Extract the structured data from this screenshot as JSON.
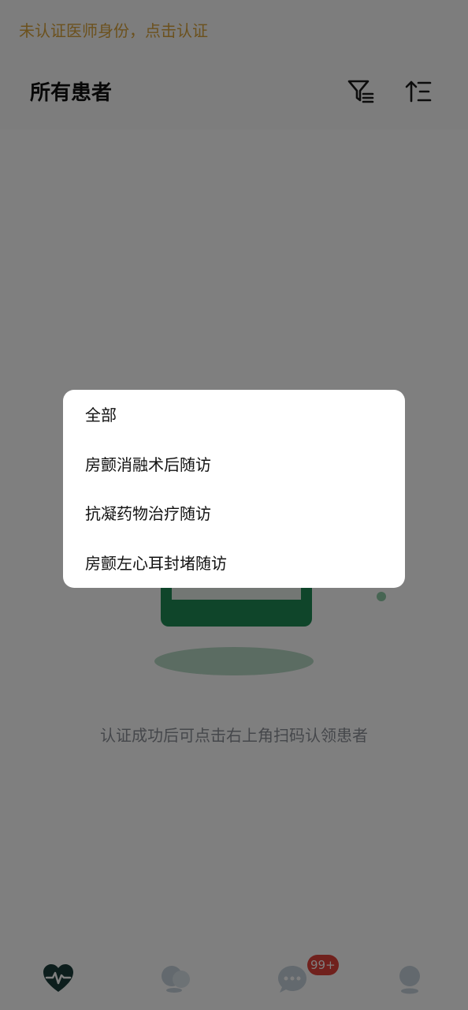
{
  "banner": {
    "text": "未认证医师身份，点击认证",
    "color": "#d8a23a"
  },
  "header": {
    "title": "所有患者",
    "icons": [
      "filter-icon",
      "sort-icon"
    ]
  },
  "empty_state": {
    "message": "认证成功后可点击右上角扫码认领患者",
    "accent_color": "#1f8a55"
  },
  "dropdown_menu": {
    "items": [
      {
        "label": "全部"
      },
      {
        "label": "房颤消融术后随访"
      },
      {
        "label": "抗凝药物治疗随访"
      },
      {
        "label": "房颤左心耳封堵随访"
      }
    ]
  },
  "tabbar": {
    "tabs": [
      {
        "icon": "heartbeat-icon",
        "active": true
      },
      {
        "icon": "patients-icon",
        "active": false
      },
      {
        "icon": "chat-icon",
        "active": false
      },
      {
        "icon": "profile-icon",
        "active": false
      }
    ],
    "chat_badge": "99+",
    "active_color": "#1a3d3a",
    "inactive_color": "#c6d3dc",
    "badge_color": "#e0433a"
  }
}
